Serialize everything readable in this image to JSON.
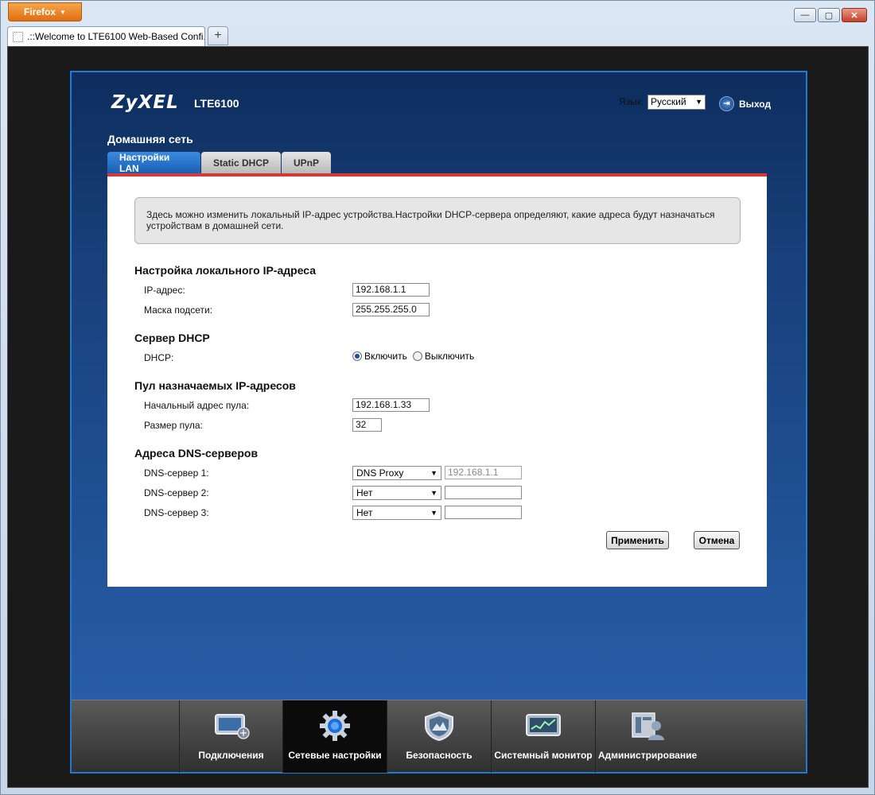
{
  "browser": {
    "menu_label": "Firefox",
    "tab_title": ".::Welcome to LTE6100 Web-Based Confi...",
    "new_tab": "+",
    "win_minimize": "—",
    "win_maximize": "▢",
    "win_close": "✕"
  },
  "header": {
    "brand": "ZyXEL",
    "model": "LTE6100",
    "language_label": "Язык:",
    "language_value": "Русский",
    "logout_label": "Выход"
  },
  "section": {
    "title": "Домашняя сеть",
    "tabs": [
      {
        "label": "Настройки LAN",
        "active": true
      },
      {
        "label": "Static DHCP",
        "active": false
      },
      {
        "label": "UPnP",
        "active": false
      }
    ]
  },
  "info_text": "Здесь можно изменить локальный IP-адрес устройства.Настройки DHCP-сервера определяют, какие адреса будут назначаться устройствам в домашней сети.",
  "local_ip": {
    "title": "Настройка локального IP-адреса",
    "ip_label": "IP-адрес:",
    "ip_value": "192.168.1.1",
    "mask_label": "Маска подсети:",
    "mask_value": "255.255.255.0"
  },
  "dhcp": {
    "title": "Сервер DHCP",
    "label": "DHCP:",
    "option_on": "Включить",
    "option_off": "Выключить",
    "selected": "on"
  },
  "pool": {
    "title": "Пул назначаемых IP-адресов",
    "start_label": "Начальный адрес пула:",
    "start_value": "192.168.1.33",
    "size_label": "Размер пула:",
    "size_value": "32"
  },
  "dns": {
    "title": "Адреса DNS-серверов",
    "servers": [
      {
        "label": "DNS-сервер 1:",
        "mode": "DNS Proxy",
        "address": "192.168.1.1"
      },
      {
        "label": "DNS-сервер 2:",
        "mode": "Нет",
        "address": ""
      },
      {
        "label": "DNS-сервер 3:",
        "mode": "Нет",
        "address": ""
      }
    ]
  },
  "actions": {
    "apply": "Применить",
    "cancel": "Отмена"
  },
  "nav": {
    "items": [
      {
        "label": "Подключения",
        "icon": "connections-icon",
        "active": false
      },
      {
        "label": "Сетевые настройки",
        "icon": "network-settings-gear-icon",
        "active": true
      },
      {
        "label": "Безопасность",
        "icon": "security-shield-icon",
        "active": false
      },
      {
        "label": "Системный монитор",
        "icon": "system-monitor-icon",
        "active": false
      },
      {
        "label": "Администрирование",
        "icon": "administration-icon",
        "active": false
      }
    ]
  },
  "colors": {
    "accent_tab": "#1b5fb3",
    "tab_underline": "#d23a3a",
    "page_bg_top": "#0d2d5d",
    "page_bg_bottom": "#2a62ad"
  }
}
